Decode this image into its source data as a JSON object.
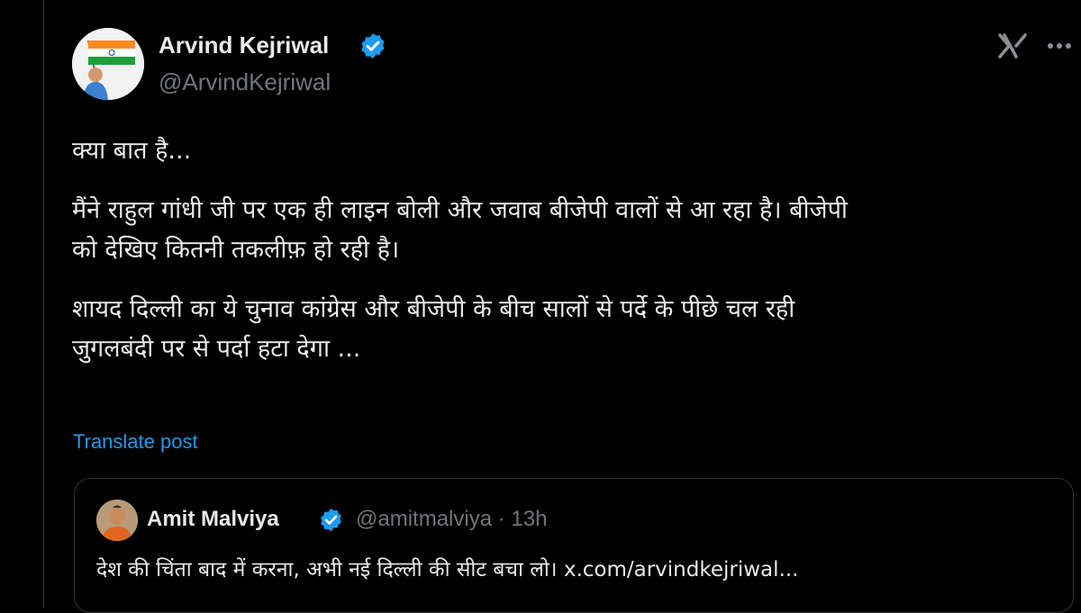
{
  "post": {
    "author": {
      "name": "Arvind Kejriwal",
      "handle": "@ArvindKejriwal",
      "verified": true,
      "avatar_icon": "avatar-holding-flag"
    },
    "body": {
      "paragraph_1": "क्या बात है...",
      "paragraph_2": "मैंने राहुल गांधी जी पर एक ही लाइन बोली और जवाब बीजेपी वालों से आ रहा है। बीजेपी\nको देखिए कितनी तकलीफ़ हो रही है।",
      "paragraph_3": "शायद दिल्ली का ये चुनाव कांग्रेस और बीजेपी के बीच सालों से पर्दे के पीछे चल रही\nजुगलबंदी पर से पर्दा हटा देगा ..."
    },
    "translate_label": "Translate post",
    "icons": {
      "platform": "x-logo-icon",
      "more": "more-options-icon",
      "verified": "verified-badge-icon"
    }
  },
  "quoted_post": {
    "author": {
      "name": "Amit Malviya",
      "handle_time": "@amitmalviya · 13h",
      "verified": true
    },
    "text": "देश की चिंता बाद में करना, अभी नई दिल्ली की सीट बचा लो। x.com/arvindkejriwal..."
  },
  "colors": {
    "background": "#000000",
    "text": "#e7e9ea",
    "muted": "#71767b",
    "link": "#1d9bf0",
    "verified": "#1d9bf0",
    "border": "#2f3336"
  }
}
